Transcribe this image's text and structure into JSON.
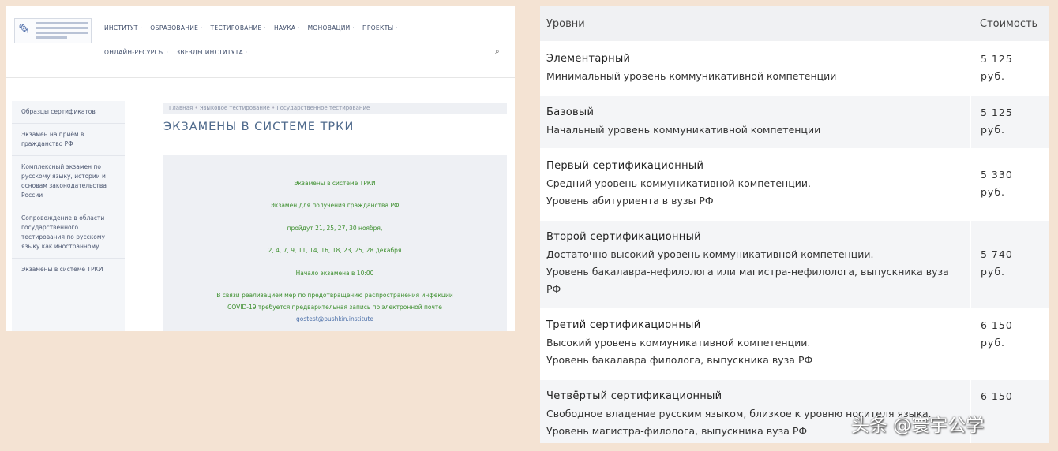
{
  "left": {
    "nav_row1": [
      "ИНСТИТУТ",
      "ОБРАЗОВАНИЕ",
      "ТЕСТИРОВАНИЕ",
      "НАУКА",
      "МОНОВАЦИИ",
      "ПРОЕКТЫ"
    ],
    "nav_row2": [
      "ОНЛАЙН-РЕСУРСЫ",
      "ЗВЕЗДЫ ИНСТИТУТА"
    ],
    "sidebar": [
      "Образцы сертификатов",
      "Экзамен на приём в гражданство РФ",
      "Комплексный экзамен по русскому языку, истории и основам законодательства России",
      "Сопровождение в области государственного тестирования по русскому языку как иностранному",
      "Экзамены в системе ТРКИ"
    ],
    "breadcrumb": [
      "Главная",
      "Языковое тестирование",
      "Государственное тестирование"
    ],
    "page_title": "ЭКЗАМЕНЫ В СИСТЕМЕ ТРКИ",
    "notice": {
      "line1": "Экзамены в системе ТРКИ",
      "line2": "Экзамен для получения гражданства РФ",
      "line3": "пройдут 21, 25, 27, 30 ноября,",
      "line4": "2, 4, 7, 9, 11, 14, 16, 18, 23, 25, 28 декабря",
      "line5": "Начало экзамена в 10:00",
      "line6": "В связи реализацией мер по предотвращению распространения инфекции",
      "line7": "COVID-19 требуется предварительная запись по электронной почте",
      "email": "gostest@pushkin.institute"
    }
  },
  "table": {
    "header_level": "Уровни",
    "header_price": "Стоимость",
    "rows": [
      {
        "name": "Элементарный",
        "desc": [
          "Минимальный уровень коммуникативной компетенции"
        ],
        "price": "5 125",
        "unit": "руб."
      },
      {
        "name": "Базовый",
        "desc": [
          "Начальный уровень коммуникативной компетенции"
        ],
        "price": "5 125",
        "unit": "руб."
      },
      {
        "name": "Первый сертификационный",
        "desc": [
          "Средний уровень коммуникативной компетенции.",
          "Уровень абитуриента в вузы РФ"
        ],
        "price": "5 330",
        "unit": "руб."
      },
      {
        "name": "Второй сертификационный",
        "desc": [
          "Достаточно высокий уровень коммуникативной компетенции.",
          "Уровень бакалавра-нефилолога или магистра-нефилолога, выпускника вуза РФ"
        ],
        "price": "5 740",
        "unit": "руб."
      },
      {
        "name": "Третий сертификационный",
        "desc": [
          "Высокий уровень коммуникативной компетенции.",
          "Уровень бакалавра филолога, выпускника вуза РФ"
        ],
        "price": "6 150",
        "unit": "руб."
      },
      {
        "name": "Четвёртый сертификационный",
        "desc": [
          "Свободное владение русским языком, близкое к уровню носителя языка.",
          "Уровень магистра-филолога, выпускника вуза РФ"
        ],
        "price": "6 150",
        "unit": ""
      }
    ]
  },
  "watermark": "头条 @寰宇公学"
}
